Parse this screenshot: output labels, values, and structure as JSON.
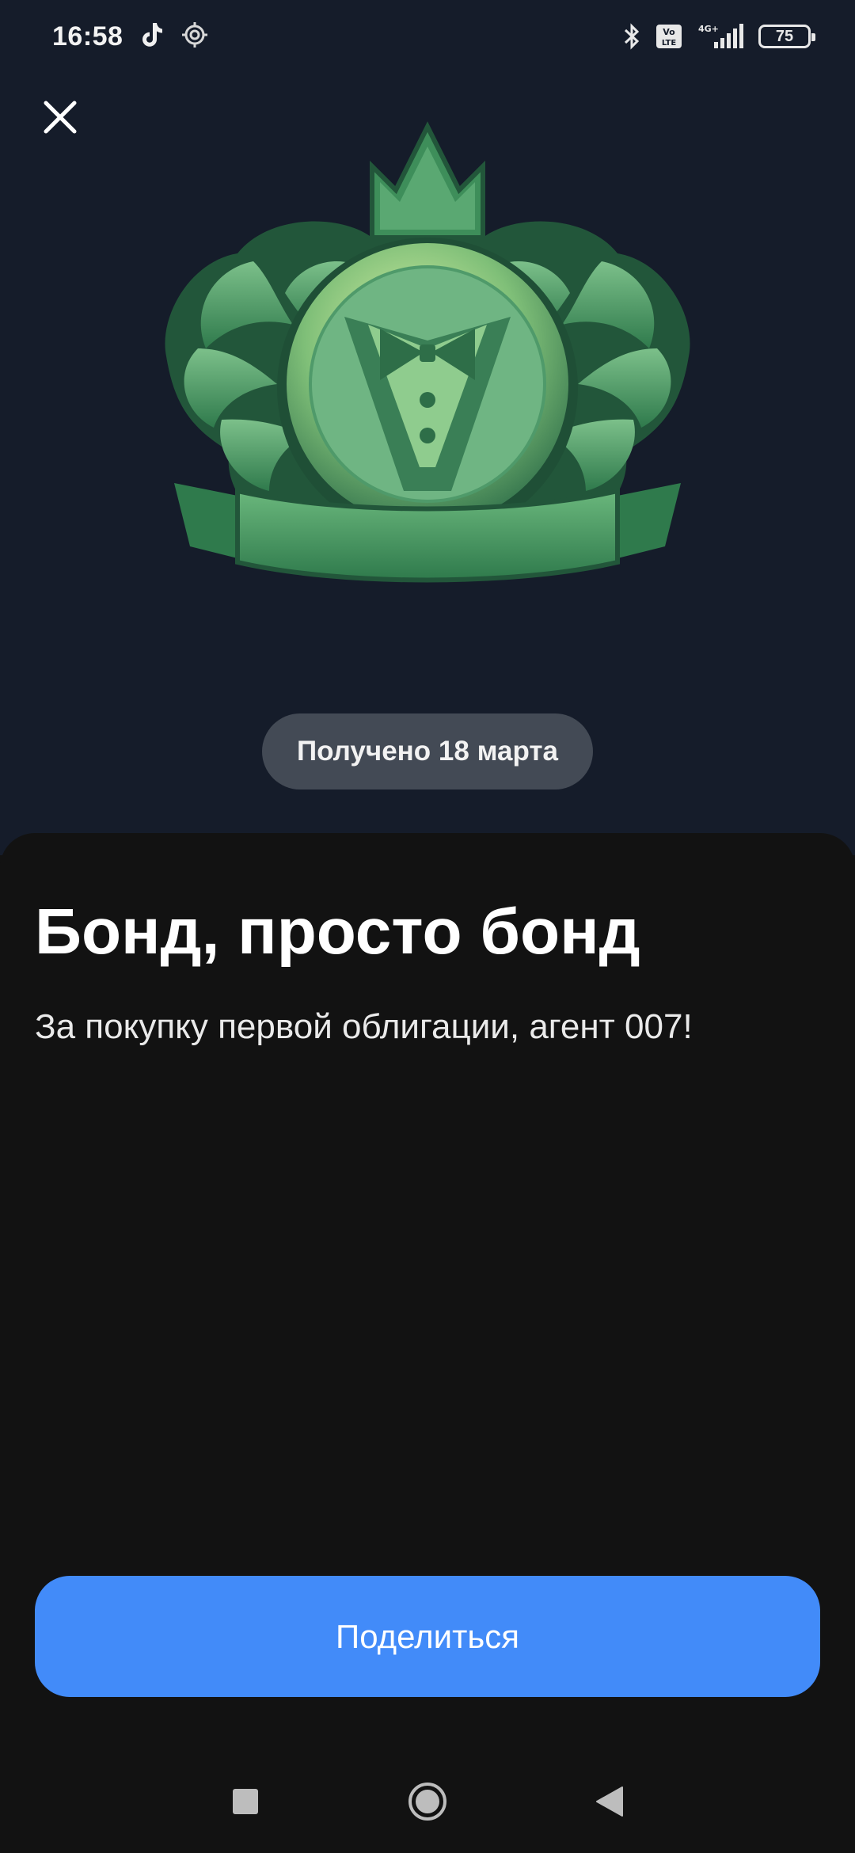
{
  "status_bar": {
    "time": "16:58",
    "battery": "75",
    "icons": [
      "tiktok-icon",
      "settings-icon",
      "bluetooth-icon",
      "volte-icon",
      "signal-4g-icon"
    ],
    "volte_label": "Vo\nLTE",
    "network_label": "4G+"
  },
  "header": {
    "close_icon": "close-icon"
  },
  "badge": {
    "emblem_icon": "tuxedo-crest-icon",
    "received_label": "Получено 18 марта"
  },
  "sheet": {
    "title": "Бонд, просто бонд",
    "description": "За покупку первой облигации, агент 007!",
    "share_label": "Поделиться"
  },
  "nav": {
    "recents_icon": "square-icon",
    "home_icon": "circle-icon",
    "back_icon": "triangle-back-icon"
  },
  "colors": {
    "top_background": "#151c2a",
    "sheet_background": "#121212",
    "pill_background": "#434a55",
    "share_button": "#428bf9",
    "emblem_green": "#3f8f5a"
  }
}
